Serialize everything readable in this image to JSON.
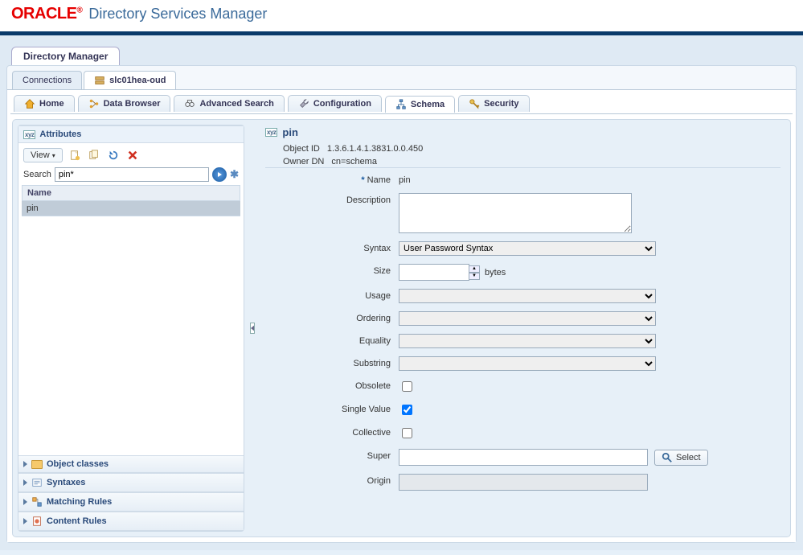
{
  "brand": "ORACLE",
  "app_title": "Directory Services Manager",
  "main_tab": "Directory Manager",
  "conn_tabs": [
    "Connections",
    "slc01hea-oud"
  ],
  "nav_tabs": {
    "home": "Home",
    "data": "Data Browser",
    "adv": "Advanced Search",
    "config": "Configuration",
    "schema": "Schema",
    "security": "Security"
  },
  "sidebar": {
    "attributes_title": "Attributes",
    "view_label": "View",
    "search_label": "Search",
    "search_value": "pin*",
    "column_header": "Name",
    "results": [
      "pin"
    ],
    "sections": {
      "object_classes": "Object classes",
      "syntaxes": "Syntaxes",
      "matching_rules": "Matching Rules",
      "content_rules": "Content Rules"
    }
  },
  "detail": {
    "title": "pin",
    "object_id_label": "Object ID",
    "object_id": "1.3.6.1.4.1.3831.0.0.450",
    "owner_dn_label": "Owner DN",
    "owner_dn": "cn=schema",
    "labels": {
      "name": "Name",
      "description": "Description",
      "syntax": "Syntax",
      "size": "Size",
      "size_units": "bytes",
      "usage": "Usage",
      "ordering": "Ordering",
      "equality": "Equality",
      "substring": "Substring",
      "obsolete": "Obsolete",
      "single_value": "Single Value",
      "collective": "Collective",
      "super": "Super",
      "select": "Select",
      "origin": "Origin"
    },
    "values": {
      "name": "pin",
      "syntax": "User Password Syntax",
      "size": "",
      "usage": "",
      "ordering": "",
      "equality": "",
      "substring": "",
      "super": "",
      "origin": "",
      "obsolete": false,
      "single_value": true,
      "collective": false
    }
  }
}
